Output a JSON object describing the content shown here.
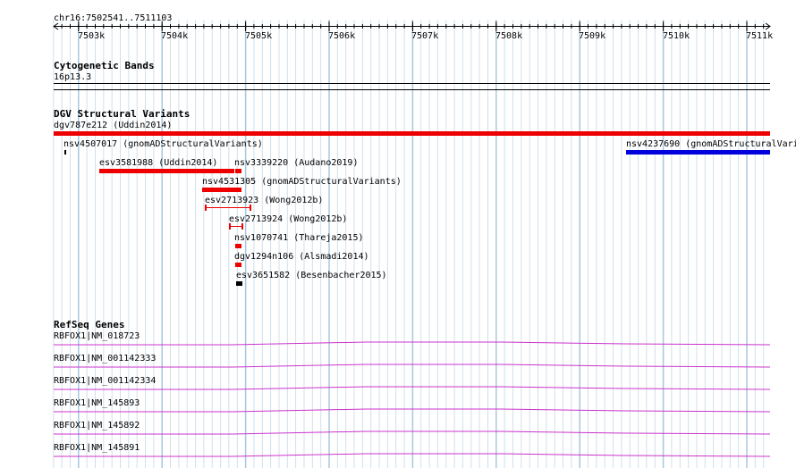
{
  "ruler": {
    "range_label": "chr16:7502541..7511103",
    "ticks": [
      "7503k",
      "7504k",
      "7505k",
      "7506k",
      "7507k",
      "7508k",
      "7509k",
      "7510k",
      "7511k"
    ]
  },
  "cytoband": {
    "title": "Cytogenetic Bands",
    "band_label": "16p13.3"
  },
  "dgv": {
    "title": "DGV Structural Variants",
    "features": [
      {
        "label": "dgv787e212 (Uddin2014)",
        "color": "#ee0000"
      },
      {
        "label": "nsv4507017 (gnomADStructuralVariants)",
        "color": "#000000"
      },
      {
        "label": "nsv4237690 (gnomADStructuralVariants)",
        "color": "#0000dd"
      },
      {
        "label": "esv3581988 (Uddin2014)",
        "color": "#ee0000"
      },
      {
        "label": "nsv3339220 (Audano2019)",
        "color": "#ee0000"
      },
      {
        "label": "nsv4531305 (gnomADStructuralVariants)",
        "color": "#ee0000"
      },
      {
        "label": "esv2713923 (Wong2012b)",
        "color": "#ee0000"
      },
      {
        "label": "esv2713924 (Wong2012b)",
        "color": "#ee0000"
      },
      {
        "label": "nsv1070741 (Thareja2015)",
        "color": "#ee0000"
      },
      {
        "label": "dgv1294n106 (Alsmadi2014)",
        "color": "#ee0000"
      },
      {
        "label": "esv3651582 (Besenbacher2015)",
        "color": "#000000"
      }
    ]
  },
  "refseq": {
    "title": "RefSeq Genes",
    "genes": [
      {
        "label": "RBFOX1|NM_018723"
      },
      {
        "label": "RBFOX1|NM_001142333"
      },
      {
        "label": "RBFOX1|NM_001142334"
      },
      {
        "label": "RBFOX1|NM_145893"
      },
      {
        "label": "RBFOX1|NM_145892"
      },
      {
        "label": "RBFOX1|NM_145891"
      }
    ],
    "line_color": "#cc33cc"
  },
  "colors": {
    "grid": "#a8c8e0",
    "dgv_gain_loss": "#ee0000",
    "dgv_gain": "#0000dd"
  }
}
